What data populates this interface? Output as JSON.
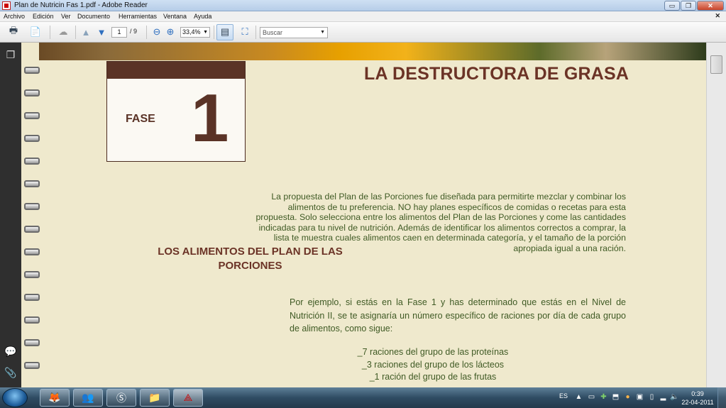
{
  "window": {
    "title": "Plan de Nutricin Fas 1.pdf - Adobe Reader",
    "controls": {
      "minimize": "▭",
      "maximize": "❐",
      "close": "✕"
    }
  },
  "menubar": {
    "items": [
      "Archivo",
      "Edición",
      "Ver",
      "Documento",
      "Herramientas",
      "Ventana",
      "Ayuda"
    ],
    "close_label": "✕"
  },
  "toolbar": {
    "page_current": "1",
    "page_total": "/ 9",
    "zoom": "33,4%",
    "search_placeholder": "Buscar"
  },
  "document": {
    "page_title": "LA DESTRUCTORA DE GRASA",
    "phase_word": "FASE",
    "phase_number": "1",
    "intro_paragraph": "La propuesta del Plan de las Porciones fue diseñada para permitirte mezclar y combinar los alimentos de tu preferencia. NO hay planes específicos de comidas o recetas para esta propuesta. Solo selecciona entre los alimentos del Plan de las Porciones y come las cantidades indicadas para tu nivel de nutrición. Además de identificar los alimentos correctos a comprar, la lista te muestra cuales alimentos caen en determinada categoría, y el tamaño de la porción apropiada igual a una ración.",
    "section_heading": "LOS ALIMENTOS DEL PLAN DE LAS PORCIONES",
    "example_paragraph": "Por ejemplo, si estás en la Fase 1 y has determinado que estás en el Nivel de Nutrición II, se te asignaría un número específico de raciones por día de cada grupo de alimentos, como sigue:",
    "list_items": [
      "_7 raciones del grupo de las proteínas",
      "_3 raciones del grupo de los lácteos",
      "_1 ración del grupo de las frutas"
    ]
  },
  "taskbar": {
    "language": "ES",
    "time": "0:39",
    "date": "22-04-2011"
  },
  "colors": {
    "page_background": "#efe9cd",
    "heading_brown": "#6b3326",
    "body_green": "#3f5a24",
    "phase_band": "#5a3326"
  }
}
